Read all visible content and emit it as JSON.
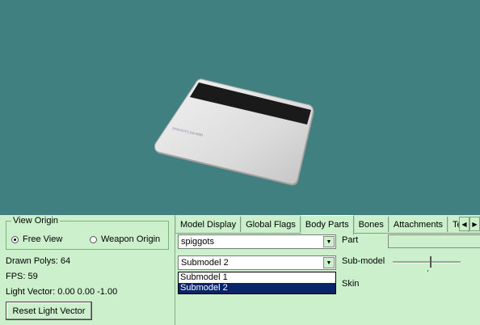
{
  "view_origin": {
    "legend": "View Origin",
    "options": [
      {
        "label": "Free View",
        "checked": true
      },
      {
        "label": "Weapon Origin",
        "checked": false
      }
    ]
  },
  "stats": {
    "drawn_polys": "Drawn Polys: 64",
    "fps": "FPS: 59",
    "light_vector": "Light Vector: 0.00 0.00 -1.00"
  },
  "reset_button": "Reset Light Vector",
  "tabs": [
    {
      "label": "Model Display",
      "active": false
    },
    {
      "label": "Global Flags",
      "active": false
    },
    {
      "label": "Body Parts",
      "active": true
    },
    {
      "label": "Bones",
      "active": false
    },
    {
      "label": "Attachments",
      "active": false
    },
    {
      "label": "Tex",
      "active": false
    }
  ],
  "body_parts": {
    "part_combo_value": "spiggots",
    "part_label": "Part",
    "submodel_combo_value": "Submodel 2",
    "submodel_label": "Sub-model",
    "skin_label": "Skin",
    "dropdown_options": [
      {
        "label": "Submodel 1",
        "selected": false
      },
      {
        "label": "Submodel 2",
        "selected": true
      }
    ]
  },
  "colors": {
    "viewport_bg": "#408080",
    "panel_bg": "#ccf0cc",
    "selection": "#0a246a"
  }
}
